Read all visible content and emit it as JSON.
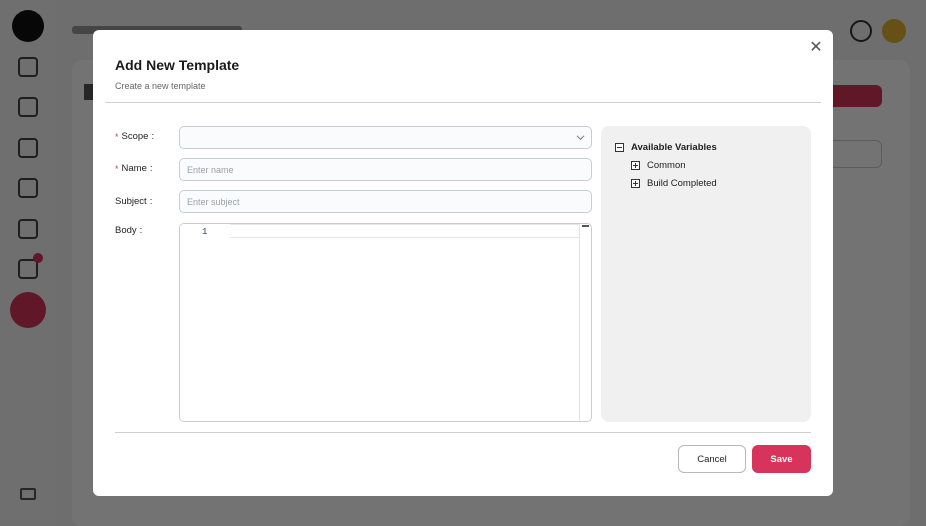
{
  "modal": {
    "title": "Add New Template",
    "subtitle": "Create a new template",
    "close_icon": "close-icon"
  },
  "form": {
    "scope": {
      "label": "Scope",
      "required": true,
      "value": "",
      "icon": "chevron-down-icon"
    },
    "name": {
      "label": "Name",
      "required": true,
      "value": "",
      "placeholder": "Enter name"
    },
    "subject": {
      "label": "Subject",
      "required": false,
      "value": "",
      "placeholder": "Enter subject"
    },
    "body": {
      "label": "Body",
      "line_numbers": [
        "1"
      ],
      "content": ""
    }
  },
  "variables": {
    "title": "Available Variables",
    "expanded": true,
    "items": [
      {
        "label": "Common",
        "expanded": false
      },
      {
        "label": "Build Completed",
        "expanded": false
      }
    ]
  },
  "footer": {
    "cancel_label": "Cancel",
    "save_label": "Save"
  },
  "colors": {
    "accent": "#d6345a",
    "overlay": "rgba(0,0,0,0.55)",
    "variables_panel_bg": "#f1f0f1"
  }
}
